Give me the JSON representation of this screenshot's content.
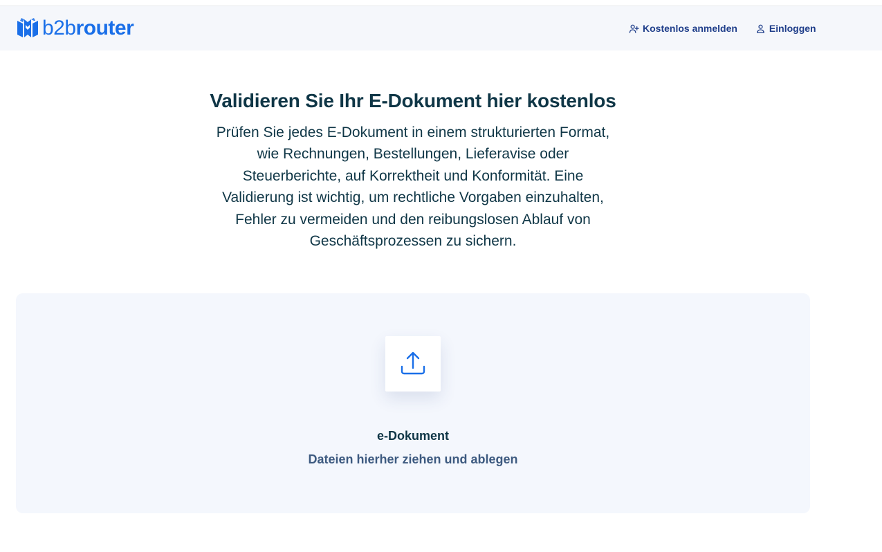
{
  "header": {
    "logo": {
      "part1": "b2b",
      "part2": "router"
    },
    "nav": [
      {
        "label": "Kostenlos anmelden",
        "icon": "user-plus-icon"
      },
      {
        "label": "Einloggen",
        "icon": "user-icon"
      }
    ]
  },
  "hero": {
    "title": "Validieren Sie Ihr E-Dokument hier kostenlos",
    "description": "Prüfen Sie jedes E-Dokument in einem strukturierten Format, wie Rechnungen, Bestellungen, Lieferavise oder Steuerberichte, auf Korrektheit und Konformität. Eine Validierung ist wichtig, um rechtliche Vorgaben einzuhalten, Fehler zu vermeiden und den reibungslosen Ablauf von Geschäftsprozessen zu sichern."
  },
  "dropzone": {
    "icon": "upload-icon",
    "title": "e-Dokument",
    "hint": "Dateien hierher ziehen und ablegen"
  },
  "colors": {
    "brand": "#1a6fe8",
    "nav_text": "#1f3e8a",
    "heading": "#0f3646",
    "dropzone_bg": "#f4f7fd"
  }
}
